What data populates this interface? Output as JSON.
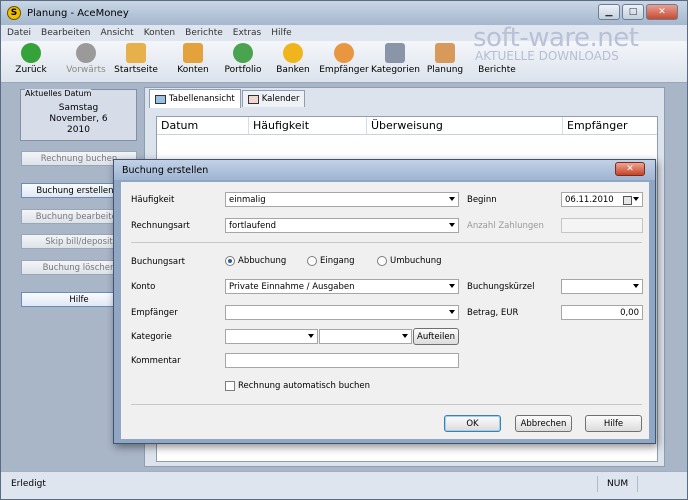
{
  "window": {
    "title": "Planung - AceMoney",
    "app_icon_letter": "S",
    "minimize": "▁",
    "maximize": "□",
    "close": "✕"
  },
  "menu": [
    "Datei",
    "Bearbeiten",
    "Ansicht",
    "Konten",
    "Berichte",
    "Extras",
    "Hilfe"
  ],
  "toolbar": {
    "back": "Zurück",
    "forward": "Vorwärts",
    "home": "Startseite",
    "accounts": "Konten",
    "portfolio": "Portfolio",
    "banks": "Banken",
    "payees": "Empfänger",
    "categories": "Kategorien",
    "planning": "Planung",
    "reports": "Berichte"
  },
  "watermark": {
    "brand": "soft-ware.net",
    "tagline": "AKTUELLE DOWNLOADS"
  },
  "left_panel": {
    "date_box_label": "Aktuelles Datum",
    "weekday": "Samstag",
    "month_day": "November, 6",
    "year": "2010",
    "buttons": [
      "Rechnung buchen",
      "Buchung erstellen...",
      "Buchung bearbeiten",
      "Skip bill/deposit",
      "Buchung löschen",
      "Hilfe"
    ]
  },
  "main": {
    "tabs": [
      "Tabellenansicht",
      "Kalender"
    ],
    "columns": [
      "Datum",
      "Häufigkeit",
      "Überweisung",
      "Empfänger"
    ]
  },
  "status": {
    "left": "Erledigt",
    "num": "NUM"
  },
  "dialog": {
    "title": "Buchung erstellen",
    "close": "✕",
    "labels": {
      "frequency": "Häufigkeit",
      "bill_type": "Rechnungsart",
      "begin": "Beginn",
      "count": "Anzahl Zahlungen",
      "booking_type": "Buchungsart",
      "account": "Konto",
      "shortcode": "Buchungskürzel",
      "payee": "Empfänger",
      "amount": "Betrag, EUR",
      "category": "Kategorie",
      "comment": "Kommentar"
    },
    "values": {
      "frequency": "einmalig",
      "bill_type": "fortlaufend",
      "begin": "06.11.2010",
      "account": "Private Einnahme / Ausgaben",
      "amount": "0,00"
    },
    "radios": {
      "debit": "Abbuchung",
      "credit": "Eingang",
      "transfer": "Umbuchung"
    },
    "split_button": "Aufteilen",
    "auto_book": "Rechnung automatisch buchen",
    "ok": "OK",
    "cancel": "Abbrechen",
    "help": "Hilfe"
  },
  "colors": {
    "accent": "#3c7fb1",
    "window_bg": "#a9b6c8",
    "dialog_frame": "#8fa6c4"
  }
}
